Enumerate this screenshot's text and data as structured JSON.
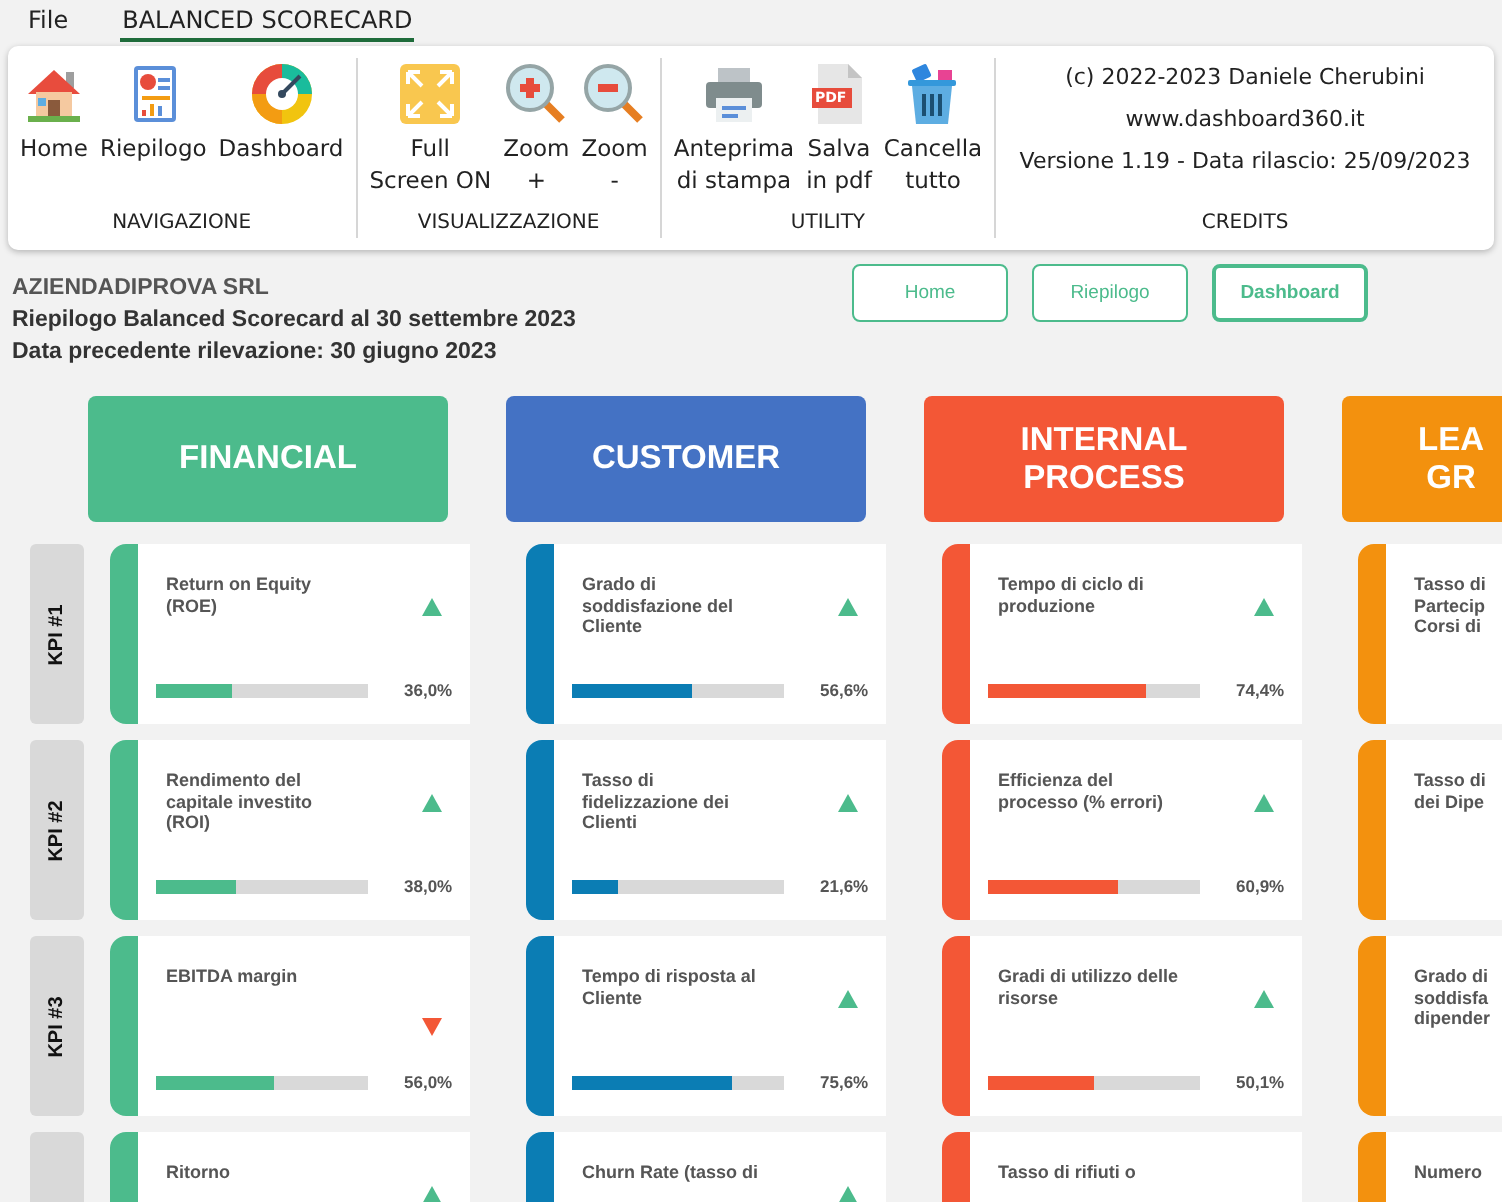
{
  "menu": [
    {
      "label": "File",
      "selected": false
    },
    {
      "label": "BALANCED SCORECARD",
      "selected": true
    }
  ],
  "ribbon": {
    "groups": [
      {
        "label": "NAVIGAZIONE",
        "buttons": [
          {
            "kind": "home",
            "label": "Home"
          },
          {
            "kind": "report",
            "label": "Riepilogo"
          },
          {
            "kind": "gauge",
            "label": "Dashboard"
          }
        ]
      },
      {
        "label": "VISUALIZZAZIONE",
        "buttons": [
          {
            "kind": "fullscreen",
            "label": "Full\nScreen ON"
          },
          {
            "kind": "zoomin",
            "label": "Zoom\n+"
          },
          {
            "kind": "zoomout",
            "label": "Zoom\n-"
          }
        ]
      },
      {
        "label": "UTILITY",
        "buttons": [
          {
            "kind": "print",
            "label": "Anteprima\ndi stampa"
          },
          {
            "kind": "pdf",
            "label": "Salva\nin pdf",
            "icon_text": "PDF"
          },
          {
            "kind": "trash",
            "label": "Cancella\ntutto"
          }
        ]
      },
      {
        "label": "CREDITS",
        "lines": [
          "(c) 2022-2023 Daniele Cherubini",
          "www.dashboard360.it",
          "Versione 1.19 - Data rilascio: 25/09/2023"
        ]
      }
    ]
  },
  "report": {
    "company": "AZIENDADIPROVA SRL",
    "subtitle": "Riepilogo Balanced Scorecard al 30 settembre 2023",
    "previous": "Data precedente rilevazione: 30 giugno 2023"
  },
  "nav_buttons": [
    {
      "label": "Home",
      "selected": false
    },
    {
      "label": "Riepilogo",
      "selected": false
    },
    {
      "label": "Dashboard",
      "selected": true
    }
  ],
  "row_labels": [
    "KPI #1",
    "KPI #2",
    "KPI #3"
  ],
  "perspectives": [
    {
      "title": "FINANCIAL",
      "color": "#4cbb8c",
      "accent": {
        "color": "#4cbb8c"
      },
      "kpis": [
        {
          "title": "Return on Equity\n(ROE)",
          "improving": true,
          "level": 0.36,
          "value": "36,0%"
        },
        {
          "title": "Rendimento del\ncapitale investito\n(ROI)",
          "improving": true,
          "level": 0.38,
          "value": "38,0%"
        },
        {
          "title": "EBITDA margin",
          "improving": false,
          "level": 0.56,
          "value": "56,0%"
        },
        {
          "title": "Ritorno",
          "improving": true
        }
      ]
    },
    {
      "title": "CUSTOMER",
      "color": "#4472c4",
      "accent": {
        "color": "#0b7db4"
      },
      "kpis": [
        {
          "title": "Grado di\nsoddisfazione del\nCliente",
          "improving": true,
          "level": 0.566,
          "value": "56,6%"
        },
        {
          "title": "Tasso di\nfidelizzazione dei\nClienti",
          "improving": true,
          "level": 0.216,
          "value": "21,6%"
        },
        {
          "title": "Tempo di risposta al\nCliente",
          "improving": true,
          "level": 0.756,
          "value": "75,6%"
        },
        {
          "title": "Churn Rate (tasso di",
          "improving": true
        }
      ]
    },
    {
      "title": "INTERNAL\nPROCESS",
      "color": "#f35736",
      "accent": {
        "color": "#f35736"
      },
      "kpis": [
        {
          "title": "Tempo di ciclo di\nproduzione",
          "improving": true,
          "level": 0.744,
          "value": "74,4%"
        },
        {
          "title": "Efficienza del\nprocesso (% errori)",
          "improving": true,
          "level": 0.609,
          "value": "60,9%"
        },
        {
          "title": "Gradi di utilizzo delle\nrisorse",
          "improving": true,
          "level": 0.501,
          "value": "50,1%"
        },
        {
          "title": "Tasso di rifiuti o"
        }
      ]
    },
    {
      "title": "LEA\nGR",
      "color": "#f3910e",
      "accent": {
        "color": "#f3910e"
      },
      "kpis": [
        {
          "title": "Tasso di\nPartecip\nCorsi di"
        },
        {
          "title": "Tasso di\ndei Dipe"
        },
        {
          "title": "Grado di\nsoddisfa\ndipender"
        },
        {
          "title": "Numero"
        }
      ]
    }
  ]
}
